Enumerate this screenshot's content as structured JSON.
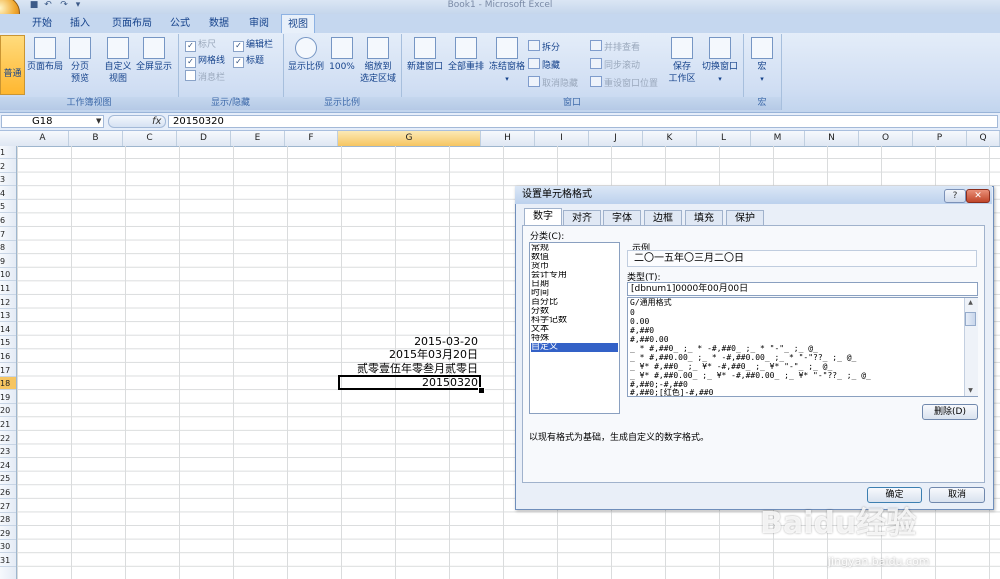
{
  "window": {
    "title": "Book1 - Microsoft Excel"
  },
  "tabs": [
    "开始",
    "插入",
    "页面布局",
    "公式",
    "数据",
    "审阅",
    "视图"
  ],
  "active_tab": "视图",
  "ribbon": {
    "groups": {
      "workbook_views": "工作簿视图",
      "show_hide": "显示/隐藏",
      "zoom": "显示比例",
      "window": "窗口",
      "macro": "宏"
    },
    "workbook_views": {
      "normal": "普通",
      "page_layout": "页面布局",
      "page_break": "分页预览",
      "custom_line1": "自定义",
      "custom_line2": "视图",
      "full_screen": "全屏显示"
    },
    "show_hide": {
      "ruler": "标尺",
      "formula_bar": "编辑栏",
      "gridlines": "网格线",
      "headings": "标题",
      "message_bar": "消息栏"
    },
    "zoom": {
      "zoom": "显示比例",
      "zoom100": "100%",
      "zoom_selection_line1": "缩放到",
      "zoom_selection_line2": "选定区域"
    },
    "window": {
      "new_window": "新建窗口",
      "arrange_all": "全部重排",
      "freeze": "冻结窗格",
      "split": "拆分",
      "hide": "隐藏",
      "unhide": "取消隐藏",
      "side_by_side": "并排查看",
      "sync_scroll": "同步滚动",
      "reset_pos": "重设窗口位置",
      "save_ws_line1": "保存",
      "save_ws_line2": "工作区",
      "switch_window": "切换窗口"
    },
    "macro": {
      "macros": "宏"
    }
  },
  "formula_bar": {
    "name_box": "G18",
    "fx": "fx",
    "value": "20150320"
  },
  "columns": [
    "A",
    "B",
    "C",
    "D",
    "E",
    "F",
    "G",
    "H",
    "I",
    "J",
    "K",
    "L",
    "M",
    "N",
    "O",
    "P",
    "Q"
  ],
  "selected_column": "G",
  "rows": [
    "1",
    "2",
    "3",
    "4",
    "5",
    "6",
    "7",
    "8",
    "9",
    "10",
    "11",
    "12",
    "13",
    "14",
    "15",
    "16",
    "17",
    "18",
    "19",
    "20",
    "21",
    "22",
    "23",
    "24",
    "25",
    "26",
    "27",
    "28",
    "29",
    "30",
    "31"
  ],
  "selected_row": "18",
  "cells": {
    "g15": "2015-03-20",
    "g16": "2015年03月20日",
    "g17": "贰零壹伍年零叁月贰零日",
    "g18": "20150320"
  },
  "dialog": {
    "title": "设置单元格格式",
    "help": "?",
    "close": "✕",
    "tabs": [
      "数字",
      "对齐",
      "字体",
      "边框",
      "填充",
      "保护"
    ],
    "active_tab": "数字",
    "category_label": "分类(C):",
    "categories": [
      "常规",
      "数值",
      "货币",
      "会计专用",
      "日期",
      "时间",
      "百分比",
      "分数",
      "科学记数",
      "文本",
      "特殊",
      "自定义"
    ],
    "selected_category": "自定义",
    "sample_label": "示例",
    "sample_value": "二〇一五年〇三月二〇日",
    "type_label": "类型(T):",
    "type_value": "[dbnum1]0000年00月00日",
    "type_list": [
      "G/通用格式",
      "0",
      "0.00",
      "#,##0",
      "#,##0.00",
      "_ * #,##0_ ;_ * -#,##0_ ;_ * \"-\"_ ;_ @_",
      "_ * #,##0.00_ ;_ * -#,##0.00_ ;_ * \"-\"??_ ;_ @_",
      "_ ¥* #,##0_ ;_ ¥* -#,##0_ ;_ ¥* \"-\"_ ;_ @_",
      "_ ¥* #,##0.00_ ;_ ¥* -#,##0.00_ ;_ ¥* \"-\"??_ ;_ @_",
      "#,##0;-#,##0",
      "#,##0;[红色]-#,##0"
    ],
    "delete_button": "删除(D)",
    "hint": "以现有格式为基础，生成自定义的数字格式。",
    "ok_button": "确定",
    "cancel_button": "取消"
  },
  "watermark": {
    "main": "Baidu经验",
    "sub": "jingyan.baidu.com"
  }
}
